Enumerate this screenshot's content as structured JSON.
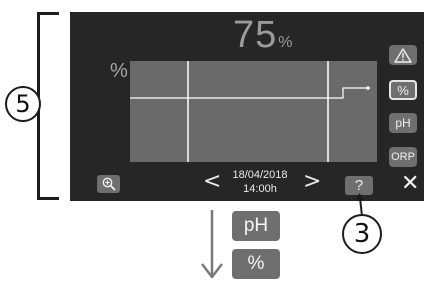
{
  "display": {
    "value": "75",
    "value_unit": "%",
    "y_axis_unit": "%"
  },
  "side_buttons": {
    "warning_icon": "warning-triangle-icon",
    "percent": "%",
    "ph": "pH",
    "orp": "ORP"
  },
  "bottom_bar": {
    "zoom_icon": "magnifier-zoom-in-icon",
    "prev": "<",
    "date": "18/04/2018",
    "time": "14:00h",
    "next": ">",
    "help": "?",
    "close": "✕"
  },
  "callouts": {
    "bracket_label": "5",
    "help_label": "3"
  },
  "sequence": {
    "first": "pH",
    "second": "%"
  },
  "colors": {
    "screen_bg": "#262626",
    "plot_bg": "#6a6a6a",
    "button_bg": "#6f6f6f",
    "trace": "#ffffff"
  }
}
